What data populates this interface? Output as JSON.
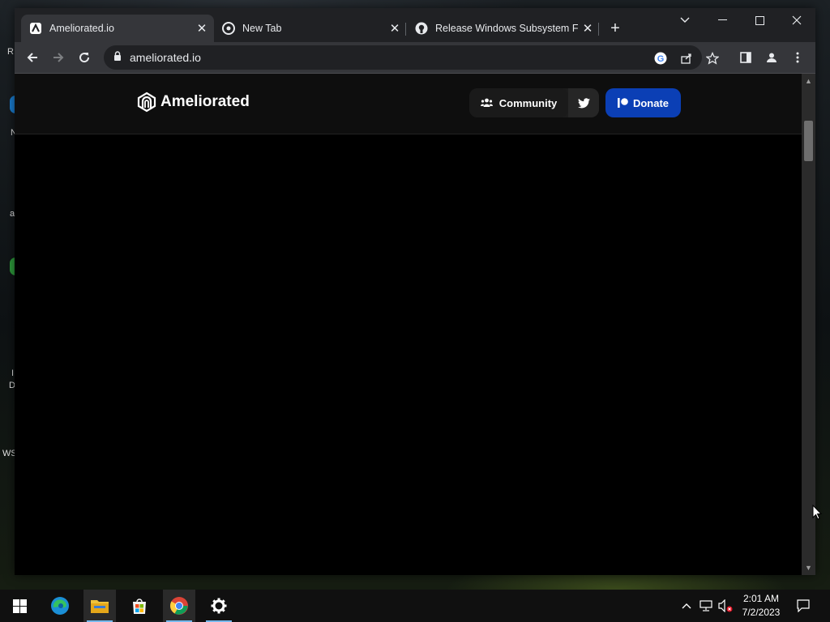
{
  "desktop": {
    "icon_labels": [
      "R",
      "N",
      "a",
      "I",
      "D",
      "WS"
    ]
  },
  "browser": {
    "tabs": [
      {
        "title": "Ameliorated.io",
        "icon": "ameliorated-favicon",
        "active": true
      },
      {
        "title": "New Tab",
        "icon": "chrome-icon",
        "active": false
      },
      {
        "title": "Release Windows Subsystem For",
        "icon": "github-icon",
        "active": false
      }
    ],
    "address": "ameliorated.io",
    "window_controls": [
      "tab-search",
      "minimize",
      "maximize",
      "close"
    ]
  },
  "site": {
    "brand": "Ameliorated",
    "nav": {
      "community_label": "Community",
      "donate_label": "Donate"
    },
    "colors": {
      "donate": "#0b3fb5",
      "header_bg": "#0e0e0e",
      "page_bg": "#000000"
    }
  },
  "taskbar": {
    "apps": [
      "start",
      "edge",
      "file-explorer",
      "microsoft-store",
      "chrome",
      "settings"
    ],
    "clock_time": "2:01 AM",
    "clock_date": "7/2/2023"
  }
}
